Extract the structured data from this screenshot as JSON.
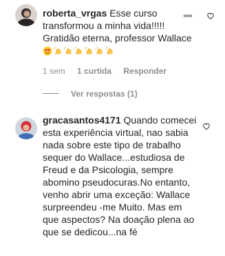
{
  "comments": [
    {
      "username": "roberta_vrgas",
      "text": "Esse curso transformou a minha vida!!!!! Gratidão eterna, professor Wallace",
      "emojis": [
        "smiling-face-with-heart-eyes",
        "clapping-hands",
        "clapping-hands",
        "clapping-hands",
        "clapping-hands",
        "clapping-hands",
        "clapping-hands"
      ],
      "time": "1 sem",
      "likes": "1 curtida",
      "reply": "Responder",
      "view_replies": "Ver respostas (1)",
      "more_icon": "more-horizontal-icon",
      "like_icon": "heart-outline-icon"
    },
    {
      "username": "gracasantos4171",
      "text": "Quando comecei esta experiência virtual, nao sabia nada sobre este tipo de trabalho sequer do Wallace...estudiosa de Freud e da Psicologia, sempre abomino pseudocuras.No entanto, venho abrir uma exceção: Wallace surpreendeu -me Muito. Mas em que aspectos? Na doação plena ao que se dedicou...na fé",
      "like_icon": "heart-outline-icon"
    }
  ],
  "colors": {
    "text": "#262626",
    "secondary": "#8e8e8e",
    "background": "#ffffff"
  }
}
